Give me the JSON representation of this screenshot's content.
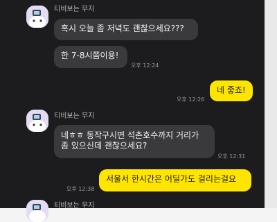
{
  "colors": {
    "background": "#1c1c1e",
    "incoming_bubble": "#3a3a3c",
    "outgoing_bubble": "#fee500",
    "avatar_bg": "#e4dbf4"
  },
  "contact": {
    "name": "티비보는 무지",
    "avatar_icon": "muzi-watching-tv-avatar"
  },
  "messages": [
    {
      "from": "them",
      "text": "혹시 오늘 좀 저녁도 괜찮으세요???",
      "time": ""
    },
    {
      "from": "them",
      "text": "한 7-8시쯤이용!",
      "time": "오후 12:24"
    },
    {
      "from": "me",
      "text": "네 좋죠!",
      "time": "오후 12:26"
    },
    {
      "from": "them",
      "line1": "네ㅎㅎ 동작구시면 석촌호수까지 거리가",
      "line2": "좀 있으신데 괜찮으세요?",
      "time": "오후 12:31"
    },
    {
      "from": "me",
      "text": "서울서 한시간은 어딜가도 걸리는걸요",
      "time": "오후 12:38"
    }
  ]
}
